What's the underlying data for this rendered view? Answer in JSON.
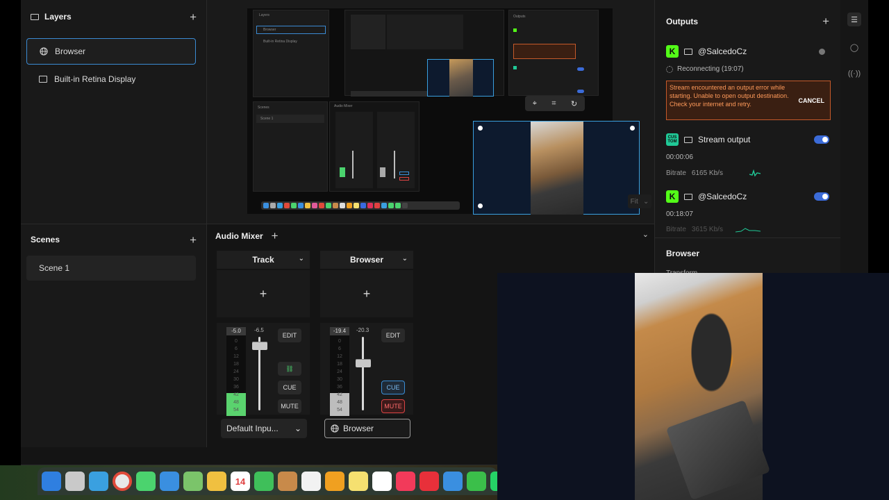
{
  "layers": {
    "title": "Layers",
    "items": [
      {
        "label": "Browser",
        "icon": "globe-icon"
      },
      {
        "label": "Built-in Retina Display",
        "icon": "monitor-icon"
      }
    ]
  },
  "scenes": {
    "title": "Scenes",
    "items": [
      {
        "label": "Scene 1"
      }
    ]
  },
  "preview": {
    "fit_label": "Fit"
  },
  "audio_mixer": {
    "title": "Audio Mixer",
    "channels": [
      {
        "name": "Track",
        "meter_value": "-5.0",
        "fader_value": "-6.5",
        "scale": [
          "0",
          "6",
          "12",
          "18",
          "24",
          "30",
          "36",
          "42",
          "48",
          "54"
        ],
        "buttons": {
          "edit": "EDIT",
          "cue": "CUE",
          "mute": "MUTE"
        },
        "source": "Default Inpu...",
        "cue_active": false,
        "mute_active": false,
        "level": 0.26,
        "fader_pos": 0.12
      },
      {
        "name": "Browser",
        "meter_value": "-19.4",
        "fader_value": "-20.3",
        "scale": [
          "0",
          "6",
          "12",
          "18",
          "24",
          "30",
          "36",
          "42",
          "48",
          "54"
        ],
        "buttons": {
          "edit": "EDIT",
          "cue": "CUE",
          "mute": "MUTE"
        },
        "source": "Browser",
        "cue_active": true,
        "mute_active": true,
        "level": 0.26,
        "fader_pos": 0.36
      }
    ]
  },
  "outputs": {
    "title": "Outputs",
    "items": [
      {
        "badge": "K",
        "badge_color": "#53fc18",
        "name": "@SalcedoCz",
        "status": "Reconnecting (19:07)",
        "error": "Stream encountered an output error while starting. Unable to open output destination. Check your internet and retry.",
        "cancel": "CANCEL"
      },
      {
        "badge": "CUS TOM",
        "badge_color": "#20c997",
        "name": "Stream output",
        "time": "00:00:06",
        "bitrate_label": "Bitrate",
        "bitrate": "6165 Kb/s",
        "enabled": true
      },
      {
        "badge": "K",
        "badge_color": "#53fc18",
        "name": "@SalcedoCz",
        "time": "00:18:07",
        "bitrate_label": "Bitrate",
        "bitrate": "3615 Kb/s",
        "enabled": true
      }
    ]
  },
  "properties": {
    "title": "Browser",
    "subtitle": "Transform"
  },
  "dock": {
    "calendar_day": "14"
  }
}
